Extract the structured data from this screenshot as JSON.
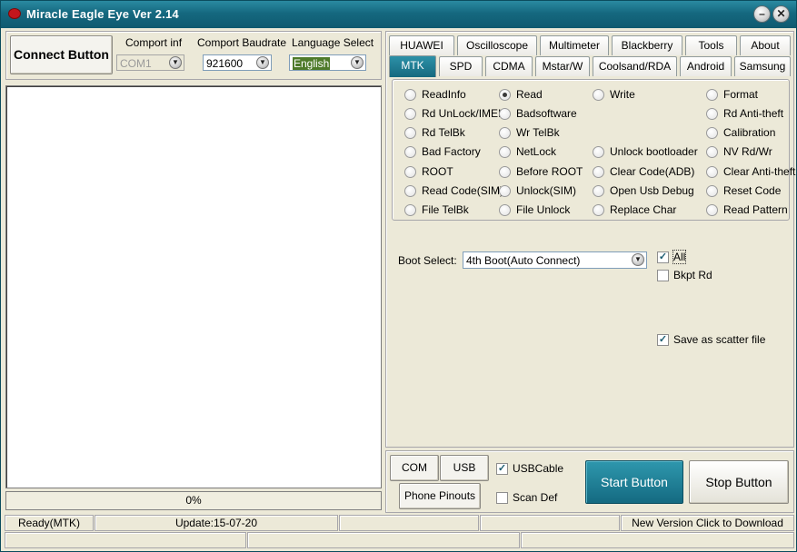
{
  "window": {
    "title": "Miracle Eagle Eye  Ver 2.14"
  },
  "top": {
    "connect_label": "Connect Button",
    "comport_label": "Comport inf",
    "comport_value": "COM1",
    "baud_label": "Comport Baudrate",
    "baud_value": "921600",
    "lang_label": "Language Select",
    "lang_value": "English"
  },
  "progress": {
    "text": "0%",
    "value": 0
  },
  "tabs_row1": [
    "HUAWEI",
    "Oscilloscope",
    "Multimeter",
    "Blackberry",
    "Tools",
    "About"
  ],
  "tabs_row2": [
    "MTK",
    "SPD",
    "CDMA",
    "Mstar/W",
    "Coolsand/RDA",
    "Android",
    "Samsung"
  ],
  "active_tab": "MTK",
  "options": {
    "col1": [
      "ReadInfo",
      "Rd UnLock/IMEI",
      "Rd TelBk",
      "Bad Factory",
      "ROOT",
      "Read Code(SIM)",
      "File TelBk"
    ],
    "col2": [
      "Read",
      "Badsoftware",
      "Wr TelBk",
      "NetLock",
      "Before ROOT",
      "Unlock(SIM)",
      "File Unlock"
    ],
    "col3": [
      "Write",
      "Unlock bootloader",
      "Clear Code(ADB)",
      "Open Usb Debug",
      "Replace Char"
    ],
    "col4": [
      "Format",
      "Rd Anti-theft",
      "Calibration",
      "NV Rd/Wr",
      "Clear Anti-theft",
      "Reset Code",
      "Read Pattern"
    ],
    "selected": "Read"
  },
  "boot": {
    "label": "Boot Select:",
    "value": "4th Boot(Auto Connect)",
    "all_label": "All",
    "all_checked": true,
    "bkpt_label": "Bkpt Rd",
    "bkpt_checked": false,
    "scatter_label": "Save as scatter file",
    "scatter_checked": true
  },
  "bottom": {
    "com_scan": "COM Scan",
    "usb_scan": "USB Scan",
    "usb_cable": "USBCable",
    "usb_cable_checked": true,
    "phone_pinouts": "Phone Pinouts",
    "scan_def": "Scan Def",
    "scan_def_checked": false,
    "start": "Start Button",
    "stop": "Stop Button"
  },
  "statusbar": {
    "ready": "Ready(MTK)",
    "update": "Update:15-07-20",
    "new_version": "New Version Click to Download"
  },
  "icons": {
    "minimize": "minimize-icon",
    "close": "close-icon",
    "combo_arrow": "chevron-down-icon",
    "app": "eagle-eye-icon"
  },
  "colors": {
    "titlebar": "#15687f",
    "start_button": "#1a6f86",
    "face": "#ece9d8"
  }
}
